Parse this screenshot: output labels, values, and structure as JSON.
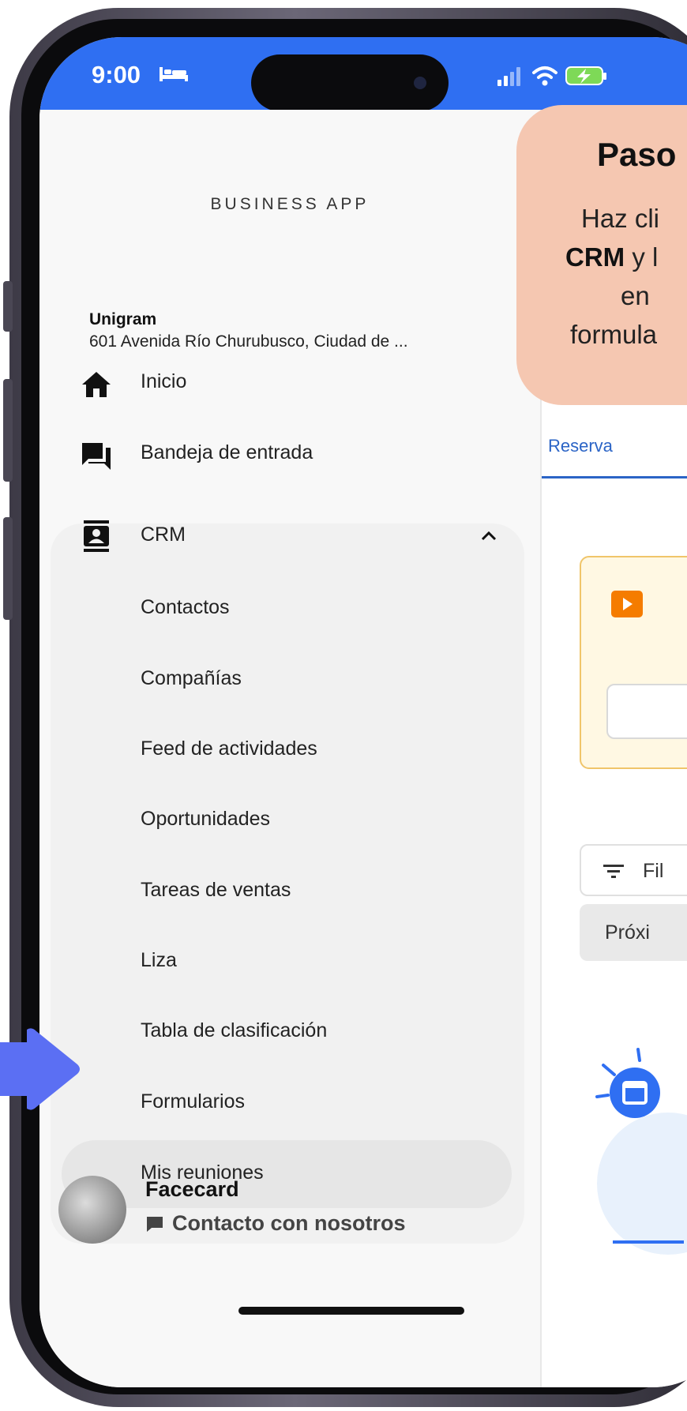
{
  "status_bar": {
    "time": "9:00",
    "accent_color": "#2f6ff2",
    "icons": [
      "bed-icon",
      "signal-icon",
      "wifi-icon",
      "battery-charging-icon"
    ]
  },
  "drawer": {
    "app_name": "BUSINESS APP",
    "business": {
      "name": "Unigram",
      "address": "601 Avenida Río Churubusco, Ciudad de ..."
    },
    "nav": {
      "home": "Inicio",
      "inbox": "Bandeja de entrada",
      "crm": "CRM"
    },
    "crm_items": [
      "Contactos",
      "Compañías",
      "Feed de actividades",
      "Oportunidades",
      "Tareas de ventas",
      "Liza",
      "Tabla de clasificación",
      "Formularios",
      "Mis reuniones"
    ],
    "selected_item": "Mis reuniones",
    "profile": {
      "name": "Facecard",
      "contact_label": "Contacto con nosotros"
    }
  },
  "main": {
    "tab_label": "Reserva",
    "filter_label": "Fil",
    "next_label": "Próxi",
    "accent_color": "#2b64c6"
  },
  "tooltip": {
    "title": "Paso",
    "line1": "Haz cli",
    "line2_bold": "CRM",
    "line2_rest": " y l",
    "line3": "en",
    "line4": "formula",
    "color": "#f5c7b1"
  },
  "pointer": {
    "color": "#5b6ff3",
    "icon": "arrow-right-icon"
  }
}
